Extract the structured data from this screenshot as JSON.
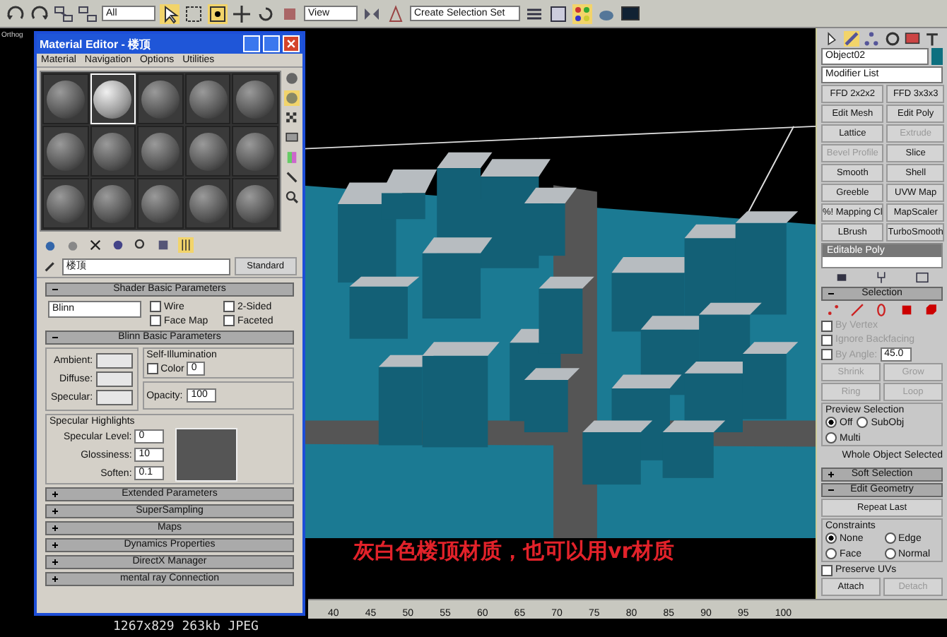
{
  "toolbar": {
    "filter_dropdown": "All",
    "view_dropdown": "View",
    "selection_set_dropdown": "Create Selection Set"
  },
  "viewport": {
    "label": "Orthog",
    "caption": "灰白色楼顶材质，也可以用vr材质"
  },
  "material_editor": {
    "title": "Material Editor - 楼顶",
    "menu": [
      "Material",
      "Navigation",
      "Options",
      "Utilities"
    ],
    "slots": [
      {
        "selected": false
      },
      {
        "selected": true
      },
      {
        "selected": false
      },
      {
        "selected": false
      },
      {
        "selected": false
      },
      {
        "selected": false
      },
      {
        "selected": false
      },
      {
        "selected": false
      },
      {
        "selected": false
      },
      {
        "selected": false
      },
      {
        "selected": false
      },
      {
        "selected": false
      },
      {
        "selected": false
      },
      {
        "selected": false
      },
      {
        "selected": false
      }
    ],
    "material_name": "楼顶",
    "material_type": "Standard",
    "shader_rollout": {
      "title": "Shader Basic Parameters",
      "expanded": true,
      "shader": "Blinn",
      "options": [
        {
          "label": "Wire",
          "checked": false
        },
        {
          "label": "2-Sided",
          "checked": false
        },
        {
          "label": "Face Map",
          "checked": false
        },
        {
          "label": "Faceted",
          "checked": false
        }
      ]
    },
    "blinn_rollout": {
      "title": "Blinn Basic Parameters",
      "expanded": true,
      "colors": [
        {
          "label": "Ambient:"
        },
        {
          "label": "Diffuse:"
        },
        {
          "label": "Specular:"
        }
      ],
      "self_illumination": {
        "title": "Self-Illumination",
        "label": "Color",
        "checked": false,
        "value": "0"
      },
      "opacity": {
        "label": "Opacity:",
        "value": "100"
      },
      "specular_highlights": {
        "title": "Specular Highlights",
        "fields": [
          {
            "label": "Specular Level:",
            "value": "0"
          },
          {
            "label": "Glossiness:",
            "value": "10"
          },
          {
            "label": "Soften:",
            "value": "0.1"
          }
        ]
      }
    },
    "rollouts": [
      {
        "title": "Extended Parameters",
        "expanded": false
      },
      {
        "title": "SuperSampling",
        "expanded": false
      },
      {
        "title": "Maps",
        "expanded": false
      },
      {
        "title": "Dynamics Properties",
        "expanded": false
      },
      {
        "title": "DirectX Manager",
        "expanded": false
      },
      {
        "title": "mental ray Connection",
        "expanded": false
      }
    ]
  },
  "command_panel": {
    "object_name": "Object02",
    "modifier_list": "Modifier List",
    "modifiers": [
      {
        "label": "FFD 2x2x2",
        "disabled": false
      },
      {
        "label": "FFD 3x3x3",
        "disabled": false
      },
      {
        "label": "Edit Mesh",
        "disabled": false
      },
      {
        "label": "Edit Poly",
        "disabled": false
      },
      {
        "label": "Lattice",
        "disabled": false
      },
      {
        "label": "Extrude",
        "disabled": true
      },
      {
        "label": "Bevel Profile",
        "disabled": true
      },
      {
        "label": "Slice",
        "disabled": false
      },
      {
        "label": "Smooth",
        "disabled": false
      },
      {
        "label": "Shell",
        "disabled": false
      },
      {
        "label": "Greeble",
        "disabled": false
      },
      {
        "label": "UVW Map",
        "disabled": false
      },
      {
        "label": "%! Mapping Cl",
        "disabled": false
      },
      {
        "label": "MapScaler",
        "disabled": false
      },
      {
        "label": "LBrush",
        "disabled": false
      },
      {
        "label": "TurboSmooth",
        "disabled": false
      }
    ],
    "stack_item": "Editable Poly",
    "selection": {
      "title": "Selection",
      "expanded": true,
      "checks": [
        {
          "label": "By Vertex",
          "checked": false,
          "disabled": true
        },
        {
          "label": "Ignore Backfacing",
          "checked": false,
          "disabled": true
        },
        {
          "label": "By Angle:",
          "checked": false,
          "disabled": true,
          "value": "45.0"
        }
      ],
      "buttons": [
        {
          "label": "Shrink",
          "disabled": true
        },
        {
          "label": "Grow",
          "disabled": true
        },
        {
          "label": "Ring",
          "disabled": true
        },
        {
          "label": "Loop",
          "disabled": true
        }
      ],
      "preview": {
        "title": "Preview Selection",
        "options": [
          {
            "label": "Off",
            "selected": true
          },
          {
            "label": "SubObj",
            "selected": false
          },
          {
            "label": "Multi",
            "selected": false
          }
        ]
      },
      "status": "Whole Object Selected"
    },
    "rollouts": [
      {
        "title": "Soft Selection",
        "expanded": false
      },
      {
        "title": "Edit Geometry",
        "expanded": true
      }
    ],
    "repeat_last": "Repeat Last",
    "constraints": {
      "title": "Constraints",
      "options": [
        {
          "label": "None",
          "selected": true
        },
        {
          "label": "Edge",
          "selected": false
        },
        {
          "label": "Face",
          "selected": false
        },
        {
          "label": "Normal",
          "selected": false
        }
      ]
    },
    "preserve_uvs": {
      "label": "Preserve UVs",
      "checked": false
    },
    "bottom_buttons": [
      {
        "label": "Attach",
        "disabled": false
      },
      {
        "label": "Detach",
        "disabled": true
      }
    ]
  },
  "time_ruler": {
    "ticks": [
      "40",
      "45",
      "50",
      "55",
      "60",
      "65",
      "70",
      "75",
      "80",
      "85",
      "90",
      "95",
      "100"
    ]
  },
  "image_info": "1267x829 263kb JPEG"
}
